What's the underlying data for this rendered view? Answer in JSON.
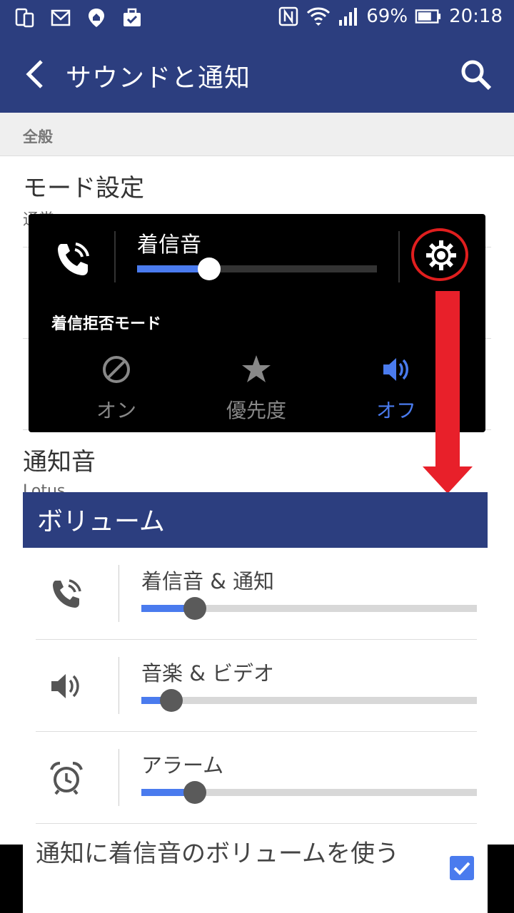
{
  "status_bar": {
    "battery": "69%",
    "time": "20:18"
  },
  "app_bar": {
    "title": "サウンドと通知"
  },
  "settings": {
    "section_header": "全般",
    "rows": [
      {
        "title": "モード設定",
        "subtitle": "通常"
      },
      {
        "title": "通知音",
        "subtitle": "Lotus"
      }
    ]
  },
  "popup": {
    "volume_label": "着信音",
    "volume_level": 0.3,
    "dnd_label": "着信拒否モード",
    "options": [
      {
        "label": "オン",
        "icon": "block-icon",
        "color": "#888888"
      },
      {
        "label": "優先度",
        "icon": "star-icon",
        "color": "#888888"
      },
      {
        "label": "オフ",
        "icon": "speaker-icon",
        "color": "#4a7bee"
      }
    ]
  },
  "volume_dialog": {
    "title": "ボリューム",
    "rows": [
      {
        "label": "着信音 & 通知",
        "icon": "phone-ring-icon",
        "level": 0.16
      },
      {
        "label": "音楽 & ビデオ",
        "icon": "speaker-icon",
        "level": 0.09
      },
      {
        "label": "アラーム",
        "icon": "alarm-clock-icon",
        "level": 0.16
      }
    ],
    "bottom_label": "通知に着信音のボリュームを使う",
    "bottom_checked": true
  },
  "colors": {
    "primary": "#2c3e7f",
    "accent": "#4a7bee",
    "annotation_red": "#e8202a"
  }
}
